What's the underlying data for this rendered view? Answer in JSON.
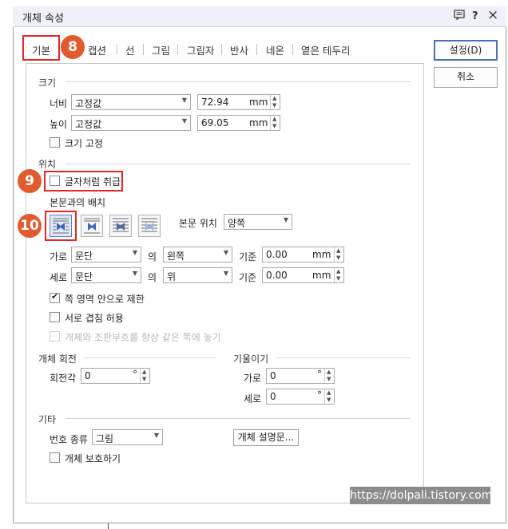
{
  "dialog": {
    "title": "개체 속성"
  },
  "titlebar_icons": {
    "help": "?",
    "close": "×"
  },
  "tabs": [
    "기본",
    "캡션",
    "선",
    "그림",
    "그림자",
    "반사",
    "네온",
    "옅은 테두리"
  ],
  "markers": {
    "m8": "8",
    "m9": "9",
    "m10": "10"
  },
  "buttons": {
    "ok": "설정(D)",
    "cancel": "취소"
  },
  "size": {
    "heading": "크기",
    "width_label": "너비",
    "width_mode": "고정값",
    "width_value": "72.94",
    "width_unit": "mm",
    "height_label": "높이",
    "height_mode": "고정값",
    "height_value": "69.05",
    "height_unit": "mm",
    "lock_label": "크기 고정"
  },
  "position": {
    "heading": "위치",
    "treat_as_char": "글자처럼 취급",
    "wrap_heading": "본문과의 배치",
    "body_pos_label": "본문 위치",
    "body_pos_value": "양쪽",
    "horiz_label": "가로",
    "horiz_ref": "문단",
    "of1": "의",
    "horiz_align": "왼쪽",
    "base1": "기준",
    "horiz_value": "0.00",
    "horiz_unit": "mm",
    "vert_label": "세로",
    "vert_ref": "문단",
    "of2": "의",
    "vert_align": "위",
    "base2": "기준",
    "vert_value": "0.00",
    "vert_unit": "mm",
    "limit_page": "쪽 영역 안으로 제한",
    "allow_overlap": "서로 겹침 허용",
    "same_page": "개체와 조판부호를 항상 같은 쪽에 놓기"
  },
  "rotation": {
    "heading": "개체 회전",
    "angle_label": "회전각",
    "angle_value": "0",
    "deg": "°"
  },
  "skew": {
    "heading": "기울이기",
    "h_label": "가로",
    "h_value": "0",
    "v_label": "세로",
    "v_value": "0",
    "deg": "°"
  },
  "other": {
    "heading": "기타",
    "number_type_label": "번호 종류",
    "number_type_value": "그림",
    "desc_button": "개체 설명문...",
    "protect_label": "개체 보호하기"
  },
  "watermark": "https://dolpali.tistory.com"
}
